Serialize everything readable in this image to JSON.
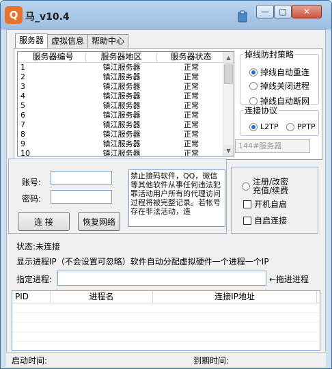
{
  "window": {
    "title": "马_v10.4",
    "minimize": "—",
    "maximize": "□",
    "close": "✕",
    "icons": {
      "app": "app-logo-icon",
      "pin": "clipboard-icon"
    }
  },
  "tabs": [
    {
      "label": "服务器"
    },
    {
      "label": "虚拟信息"
    },
    {
      "label": "帮助中心"
    }
  ],
  "server_list": {
    "columns": [
      "服务器编号",
      "服务器地区",
      "服务器状态"
    ],
    "rows": [
      {
        "id": "1",
        "region": "镇江服务器",
        "status": "正常"
      },
      {
        "id": "2",
        "region": "镇江服务器",
        "status": "正常"
      },
      {
        "id": "3",
        "region": "镇江服务器",
        "status": "正常"
      },
      {
        "id": "4",
        "region": "镇江服务器",
        "status": "正常"
      },
      {
        "id": "5",
        "region": "镇江服务器",
        "status": "正常"
      },
      {
        "id": "6",
        "region": "镇江服务器",
        "status": "正常"
      },
      {
        "id": "7",
        "region": "镇江服务器",
        "status": "正常"
      },
      {
        "id": "8",
        "region": "镇江服务器",
        "status": "正常"
      },
      {
        "id": "9",
        "region": "镇江服务器",
        "status": "正常"
      },
      {
        "id": "10",
        "region": "镇江服务器",
        "status": "正常"
      }
    ]
  },
  "anti_ban": {
    "legend": "掉线防封策略",
    "options": [
      "掉线自动重连",
      "掉线关闭进程",
      "掉线自动断网"
    ],
    "selected": 0
  },
  "protocol": {
    "legend": "连接协议",
    "options": [
      "L2TP",
      "PPTP"
    ],
    "selected": 0
  },
  "server_select": {
    "value": "144#服务器"
  },
  "login": {
    "account_label": "账号:",
    "password_label": "密码:",
    "account_value": "",
    "password_value": "",
    "connect_button": "连 接",
    "restore_button": "恢复网络"
  },
  "notice_text": "禁止接码软件，QQ，微信等其他软件从事任何违法犯罪活动用户所有的代理访问过程将被完整记录。若帐号存在非法活动，造",
  "options_panel": {
    "register": "注册/改密\n充值/续费",
    "autostart": "开机自启",
    "autoconnect": "自启连接"
  },
  "status": {
    "label": "状态:",
    "value": "未连接"
  },
  "process_hint": "显示进程IP（不会设置可忽略）软件自动分配虚拟硬件一个进程一个IP",
  "process": {
    "label": "指定进程:",
    "value": "",
    "drag_hint": "←拖进进程"
  },
  "process_list": {
    "columns": [
      "PID",
      "进程名",
      "连接IP地址"
    ]
  },
  "statusbar": {
    "start_label": "启动时间:",
    "expire_label": "到期时间:"
  }
}
